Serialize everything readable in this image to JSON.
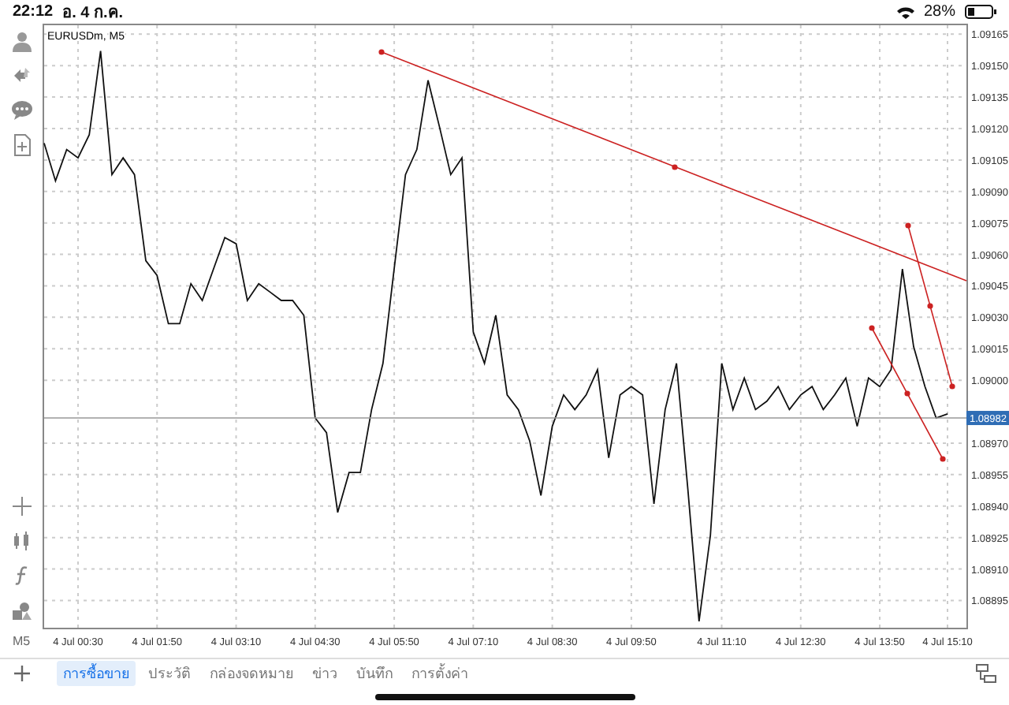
{
  "status_bar": {
    "time": "22:12",
    "date": "อ. 4 ก.ค.",
    "battery": "28%"
  },
  "toolbar": {
    "timeframe": "M5"
  },
  "chart": {
    "title": "EURUSDm, M5",
    "chart_data": {
      "type": "line",
      "grid": true,
      "ylim": [
        1.08882,
        1.0917
      ],
      "categories": [
        null,
        null,
        null,
        "4 Jul 00:30",
        null,
        null,
        null,
        null,
        null,
        null,
        "4 Jul 01:50",
        null,
        null,
        null,
        null,
        null,
        null,
        "4 Jul 03:10",
        null,
        null,
        null,
        null,
        null,
        null,
        "4 Jul 04:30",
        null,
        null,
        null,
        null,
        null,
        null,
        "4 Jul 05:50",
        null,
        null,
        null,
        null,
        null,
        null,
        "4 Jul 07:10",
        null,
        null,
        null,
        null,
        null,
        null,
        "4 Jul 08:30",
        null,
        null,
        null,
        null,
        null,
        null,
        "4 Jul 09:50",
        null,
        null,
        null,
        null,
        null,
        null,
        null,
        "4 Jul 11:10",
        null,
        null,
        null,
        null,
        null,
        null,
        "4 Jul 12:30",
        null,
        null,
        null,
        null,
        null,
        null,
        "4 Jul 13:50",
        null,
        null,
        null,
        null,
        null,
        "4 Jul 15:10"
      ],
      "yticks": [
        {
          "value": 1.09165,
          "label": "1.09165"
        },
        {
          "value": 1.0915,
          "label": "1.09150"
        },
        {
          "value": 1.09135,
          "label": "1.09135"
        },
        {
          "value": 1.0912,
          "label": "1.09120"
        },
        {
          "value": 1.09105,
          "label": "1.09105"
        },
        {
          "value": 1.0909,
          "label": "1.09090"
        },
        {
          "value": 1.09075,
          "label": "1.09075"
        },
        {
          "value": 1.0906,
          "label": "1.09060"
        },
        {
          "value": 1.09045,
          "label": "1.09045"
        },
        {
          "value": 1.0903,
          "label": "1.09030"
        },
        {
          "value": 1.09015,
          "label": "1.09015"
        },
        {
          "value": 1.09,
          "label": "1.09000"
        },
        {
          "value": 1.0897,
          "label": "1.08970"
        },
        {
          "value": 1.08955,
          "label": "1.08955"
        },
        {
          "value": 1.0894,
          "label": "1.08940"
        },
        {
          "value": 1.08925,
          "label": "1.08925"
        },
        {
          "value": 1.0891,
          "label": "1.08910"
        },
        {
          "value": 1.08895,
          "label": "1.08895"
        }
      ],
      "series": [
        {
          "color": "#111111",
          "values": [
            1.09113,
            1.09095,
            1.0911,
            1.09106,
            1.09117,
            1.09157,
            1.09098,
            1.09106,
            1.09098,
            1.09057,
            1.0905,
            1.09027,
            1.09027,
            1.09046,
            1.09038,
            1.09053,
            1.09068,
            1.09065,
            1.09038,
            1.09046,
            1.09042,
            1.09038,
            1.09038,
            1.09031,
            1.08982,
            1.08975,
            1.08937,
            1.08956,
            1.08956,
            1.08986,
            1.09008,
            1.09053,
            1.09098,
            1.0911,
            1.09143,
            1.09121,
            1.09098,
            1.09106,
            1.09023,
            1.09008,
            1.09031,
            1.08993,
            1.08986,
            1.08971,
            1.08945,
            1.08978,
            1.08993,
            1.08986,
            1.08993,
            1.09005,
            1.08963,
            1.08993,
            1.08997,
            1.08993,
            1.08941,
            1.08986,
            1.09008,
            1.08948,
            1.08885,
            1.08926,
            1.09008,
            1.08986,
            1.09001,
            1.08986,
            1.0899,
            1.08997,
            1.08986,
            1.08993,
            1.08997,
            1.08986,
            1.08993,
            1.09001,
            1.08978,
            1.09001,
            1.08997,
            1.09005,
            1.09053,
            1.09016,
            1.08997,
            1.08982,
            1.08984
          ]
        }
      ]
    },
    "current_price": "1.08982"
  },
  "tabs": [
    {
      "label": "การซื้อขาย",
      "selected": true
    },
    {
      "label": "ประวัติ",
      "selected": false
    },
    {
      "label": "กล่องจดหมาย",
      "selected": false
    },
    {
      "label": "ข่าว",
      "selected": false
    },
    {
      "label": "บันทึก",
      "selected": false
    },
    {
      "label": "การตั้งค่า",
      "selected": false
    }
  ]
}
